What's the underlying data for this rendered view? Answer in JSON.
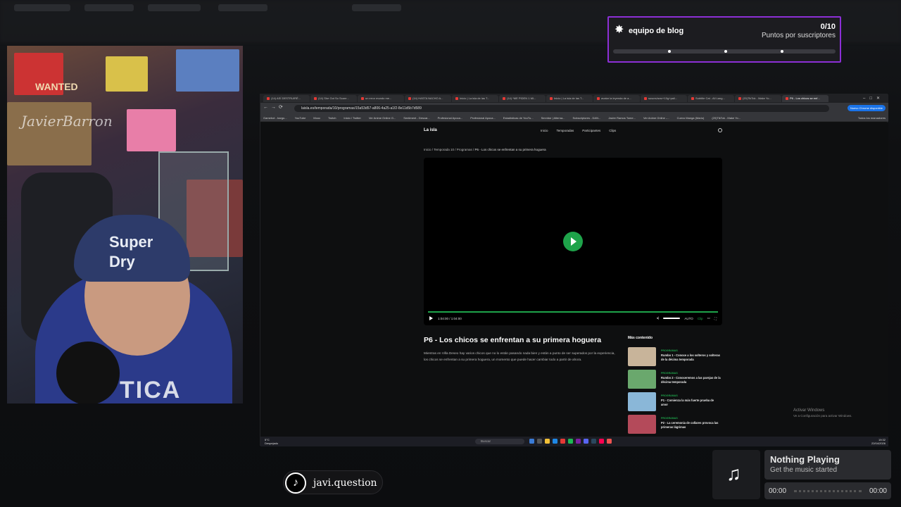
{
  "goal": {
    "title": "equipo de blog",
    "count": "0/10",
    "subtitle": "Puntos por suscriptores",
    "progress": 0
  },
  "browser": {
    "tabs": [
      "(14) ASÍ DESTRUIRÉ...",
      "(14) She Got So Scare...",
      "un error mundo me...",
      "(14) HASTA NACHO A...",
      "Inicio | La isla de las T...",
      "(14) *ME PIDEN 1 MI...",
      "Inicio | La isla de las T...",
      "avatar la leyenda de a...",
      "suscrs/avsr+10g+pali...",
      "Subtitle Cat - All Lang...",
      "(20)TikTok - Make Yo...",
      "P6 - Los chicos se enf..."
    ],
    "url": "laisla.es/temporada/10/programas/15a53d57-a806-4a25-a1f2-8e11d5b7d589",
    "update_label": "Nuevo Chrome disponible",
    "bookmarks": [
      "Gamebot - bargo...",
      "YouTube",
      "Mooc",
      "Twitch",
      "Inicio / Twitter",
      "Ver Anime Online G...",
      "Sentiment - Descar...",
      "Profesional Apoca...",
      "Profesional Apoca...",
      "Estadísticas de YouTu...",
      "Servidor | Alterna...",
      "Subscriptores - DAN...",
      "Javier Ramos Tome...",
      "Ver Anime Online -...",
      "Cuevo Manga (Mario)",
      "(20)TikTok - Make Yo..."
    ],
    "all_bookmarks": "Todos los marcadores"
  },
  "site": {
    "logo": "La isla",
    "menu": [
      "Inicio",
      "Temporadas",
      "Participantes",
      "Clips"
    ],
    "breadcrumb": {
      "home": "Inicio",
      "season": "Temporada 10",
      "section": "Programas",
      "current": "P6 - Los chicos se enfrentan a su primera hoguera"
    },
    "player": {
      "time": "1:04:00 / 1:04:00",
      "quality": "AUTO",
      "clip": "Clip"
    },
    "episode_title": "P6 - Los chicos se enfrentan a su primera hoguera",
    "episode_desc": "Mientras en Villa Deseo hay varios chicos que no lo están pasando nada bien y están a punto de ser superados por la experiencia, los chicos se enfrentan a su primera hoguera, un momento que puede hacer cambiar todo a partir de ahora.",
    "more_heading": "Más contenido",
    "more": [
      {
        "category": "PROGRAMAS",
        "title": "Rumbo 1 - Conoce a los solteros y solteras de la décima temporada",
        "color": "#c8b49a"
      },
      {
        "category": "PROGRAMAS",
        "title": "Rumbo 2 - Conoceremos a las parejas de la décima temporada",
        "color": "#6aa86d"
      },
      {
        "category": "PROGRAMAS",
        "title": "P1 - Comienza la más fuerte prueba de amor",
        "color": "#8ab7d8"
      },
      {
        "category": "PROGRAMAS",
        "title": "P2 - La ceremonia de collares provoca las primeras lágrimas",
        "color": "#b44a5a"
      }
    ],
    "activate_title": "Activar Windows",
    "activate_sub": "Ve a Configuración para activar Windows."
  },
  "taskbar": {
    "weather": "5°C\nDespejado",
    "search": "Buscar",
    "time": "19:32",
    "date": "22/04/2026"
  },
  "tiktok": {
    "handle": "javi.question"
  },
  "webcam": {
    "wanted": "WANTED",
    "signature": "JavierBarron",
    "cap": "Super Dry",
    "shirt": "TICA"
  },
  "music": {
    "title": "Nothing Playing",
    "subtitle": "Get the music started",
    "start": "00:00",
    "end": "00:00"
  }
}
